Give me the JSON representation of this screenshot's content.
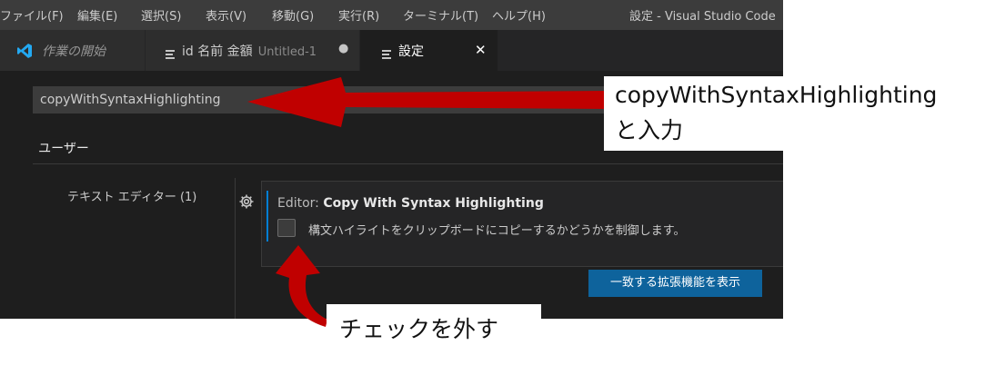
{
  "menubar": {
    "items": [
      "ファイル(F)",
      "編集(E)",
      "選択(S)",
      "表示(V)",
      "移動(G)",
      "実行(R)",
      "ターミナル(T)",
      "ヘルプ(H)"
    ],
    "window_title": "設定 - Visual Studio Code"
  },
  "tabs": [
    {
      "label": "作業の開始",
      "icon": "vscode-logo-icon"
    },
    {
      "label": "id 名前 金額",
      "sublabel": "Untitled-1",
      "icon": "file-lines-icon",
      "modified_marker": "●"
    },
    {
      "label": "設定",
      "icon": "file-lines-icon",
      "close": "✕"
    }
  ],
  "search": {
    "value": "copyWithSyntaxHighlighting"
  },
  "scope_tab": {
    "label": "ユーザー"
  },
  "toc": {
    "item": "テキスト エディター (1)"
  },
  "setting": {
    "category": "Editor: ",
    "name": "Copy With Syntax Highlighting",
    "description": "構文ハイライトをクリップボードにコピーするかどうかを制御します。",
    "checked": true,
    "gear_icon": "gear-icon"
  },
  "extensions_button": {
    "label": "一致する拡張機能を表示"
  },
  "annotations": {
    "top_line1": "copyWithSyntaxHighlighting",
    "top_line2": "と入力",
    "bottom": "チェックを外す",
    "arrow_color": "#c00000"
  },
  "colors": {
    "accent": "#007fd4",
    "button": "#0e639c"
  }
}
